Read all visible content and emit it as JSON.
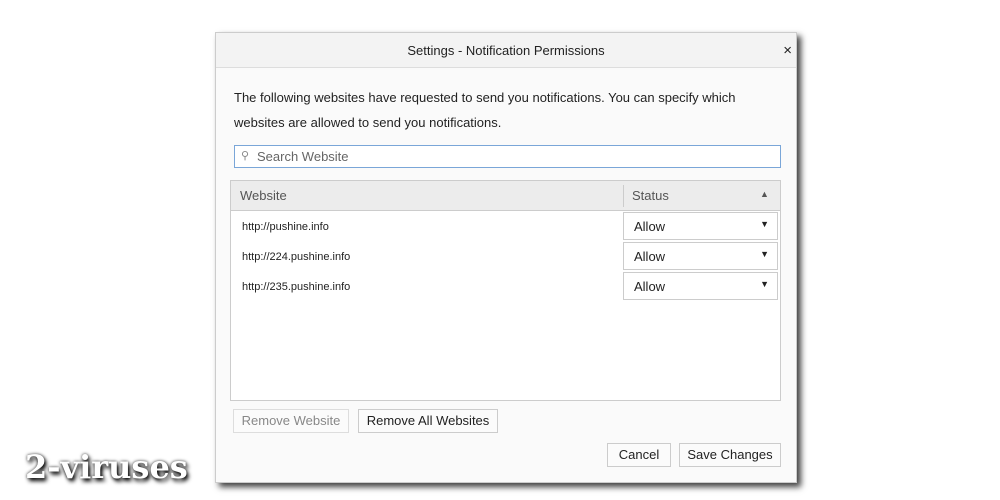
{
  "dialog": {
    "title": "Settings - Notification Permissions",
    "description": "The following websites have requested to send you notifications. You can specify which websites are allowed to send you notifications.",
    "search": {
      "placeholder": "Search Website",
      "value": ""
    },
    "table": {
      "headers": {
        "website": "Website",
        "status": "Status"
      },
      "rows": [
        {
          "url": "http://pushine.info",
          "status": "Allow"
        },
        {
          "url": "http://224.pushine.info",
          "status": "Allow"
        },
        {
          "url": "http://235.pushine.info",
          "status": "Allow"
        }
      ]
    },
    "buttons": {
      "remove": "Remove Website",
      "remove_all": "Remove All Websites",
      "cancel": "Cancel",
      "save": "Save Changes"
    },
    "close": "×"
  },
  "watermark": "2-viruses"
}
